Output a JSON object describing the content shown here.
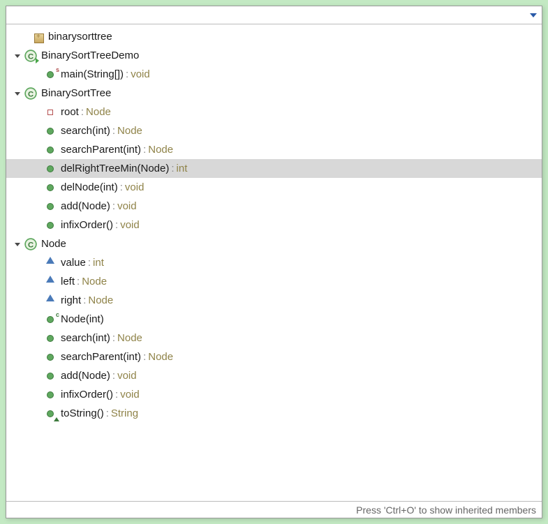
{
  "search": {
    "placeholder": "",
    "value": ""
  },
  "tree": [
    {
      "id": "pkg",
      "indent": 28,
      "icon": "package",
      "toggle": null,
      "name": "binarysorttree",
      "type": null,
      "selected": false,
      "modifier": null
    },
    {
      "id": "cls1",
      "indent": 0,
      "icon": "class-run",
      "toggle": "open",
      "name": "BinarySortTreeDemo",
      "type": null,
      "selected": false,
      "modifier": null
    },
    {
      "id": "m-main",
      "indent": 46,
      "icon": "method",
      "toggle": null,
      "name": "main(String[])",
      "type": "void",
      "selected": false,
      "modifier": "s"
    },
    {
      "id": "cls2",
      "indent": 0,
      "icon": "class",
      "toggle": "open",
      "name": "BinarySortTree",
      "type": null,
      "selected": false,
      "modifier": null
    },
    {
      "id": "f-root",
      "indent": 46,
      "icon": "field-private",
      "toggle": null,
      "name": "root",
      "type": "Node",
      "selected": false,
      "modifier": null
    },
    {
      "id": "m-search",
      "indent": 46,
      "icon": "method",
      "toggle": null,
      "name": "search(int)",
      "type": "Node",
      "selected": false,
      "modifier": null
    },
    {
      "id": "m-searchparent",
      "indent": 46,
      "icon": "method",
      "toggle": null,
      "name": "searchParent(int)",
      "type": "Node",
      "selected": false,
      "modifier": null
    },
    {
      "id": "m-delright",
      "indent": 46,
      "icon": "method",
      "toggle": null,
      "name": "delRightTreeMin(Node)",
      "type": "int",
      "selected": true,
      "modifier": null
    },
    {
      "id": "m-delnode",
      "indent": 46,
      "icon": "method",
      "toggle": null,
      "name": "delNode(int)",
      "type": "void",
      "selected": false,
      "modifier": null
    },
    {
      "id": "m-add",
      "indent": 46,
      "icon": "method",
      "toggle": null,
      "name": "add(Node)",
      "type": "void",
      "selected": false,
      "modifier": null
    },
    {
      "id": "m-infix",
      "indent": 46,
      "icon": "method",
      "toggle": null,
      "name": "infixOrder()",
      "type": "void",
      "selected": false,
      "modifier": null
    },
    {
      "id": "cls3",
      "indent": 0,
      "icon": "class",
      "toggle": "open",
      "name": "Node",
      "type": null,
      "selected": false,
      "modifier": null
    },
    {
      "id": "f-value",
      "indent": 46,
      "icon": "field-default",
      "toggle": null,
      "name": "value",
      "type": "int",
      "selected": false,
      "modifier": null
    },
    {
      "id": "f-left",
      "indent": 46,
      "icon": "field-default",
      "toggle": null,
      "name": "left",
      "type": "Node",
      "selected": false,
      "modifier": null
    },
    {
      "id": "f-right",
      "indent": 46,
      "icon": "field-default",
      "toggle": null,
      "name": "right",
      "type": "Node",
      "selected": false,
      "modifier": null
    },
    {
      "id": "m-nodecons",
      "indent": 46,
      "icon": "method",
      "toggle": null,
      "name": "Node(int)",
      "type": null,
      "selected": false,
      "modifier": "c"
    },
    {
      "id": "m-nsearch",
      "indent": 46,
      "icon": "method",
      "toggle": null,
      "name": "search(int)",
      "type": "Node",
      "selected": false,
      "modifier": null
    },
    {
      "id": "m-nsearchp",
      "indent": 46,
      "icon": "method",
      "toggle": null,
      "name": "searchParent(int)",
      "type": "Node",
      "selected": false,
      "modifier": null
    },
    {
      "id": "m-nadd",
      "indent": 46,
      "icon": "method",
      "toggle": null,
      "name": "add(Node)",
      "type": "void",
      "selected": false,
      "modifier": null
    },
    {
      "id": "m-ninfix",
      "indent": 46,
      "icon": "method",
      "toggle": null,
      "name": "infixOrder()",
      "type": "void",
      "selected": false,
      "modifier": null
    },
    {
      "id": "m-tostring",
      "indent": 46,
      "icon": "method",
      "toggle": null,
      "name": "toString()",
      "type": "String",
      "selected": false,
      "modifier": "override"
    }
  ],
  "status": {
    "text": "Press 'Ctrl+O' to show inherited members"
  }
}
